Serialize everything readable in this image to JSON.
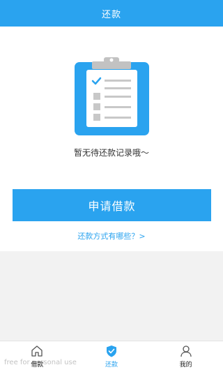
{
  "header": {
    "title": "还款"
  },
  "empty_state": {
    "message": "暂无待还款记录哦～",
    "illustration_icon": "clipboard-checklist-icon"
  },
  "actions": {
    "apply_loan_label": "申请借款",
    "faq_link_label": "还款方式有哪些？>"
  },
  "tabbar": {
    "tabs": [
      {
        "label": "借款",
        "icon": "home-icon",
        "active": false
      },
      {
        "label": "还款",
        "icon": "shield-check-icon",
        "active": true
      },
      {
        "label": "我的",
        "icon": "user-icon",
        "active": false
      }
    ]
  },
  "watermark": {
    "text": "free for personal use"
  },
  "colors": {
    "primary": "#2aa3ef",
    "background_grey": "#f2f2f2",
    "text_dark": "#333333"
  }
}
